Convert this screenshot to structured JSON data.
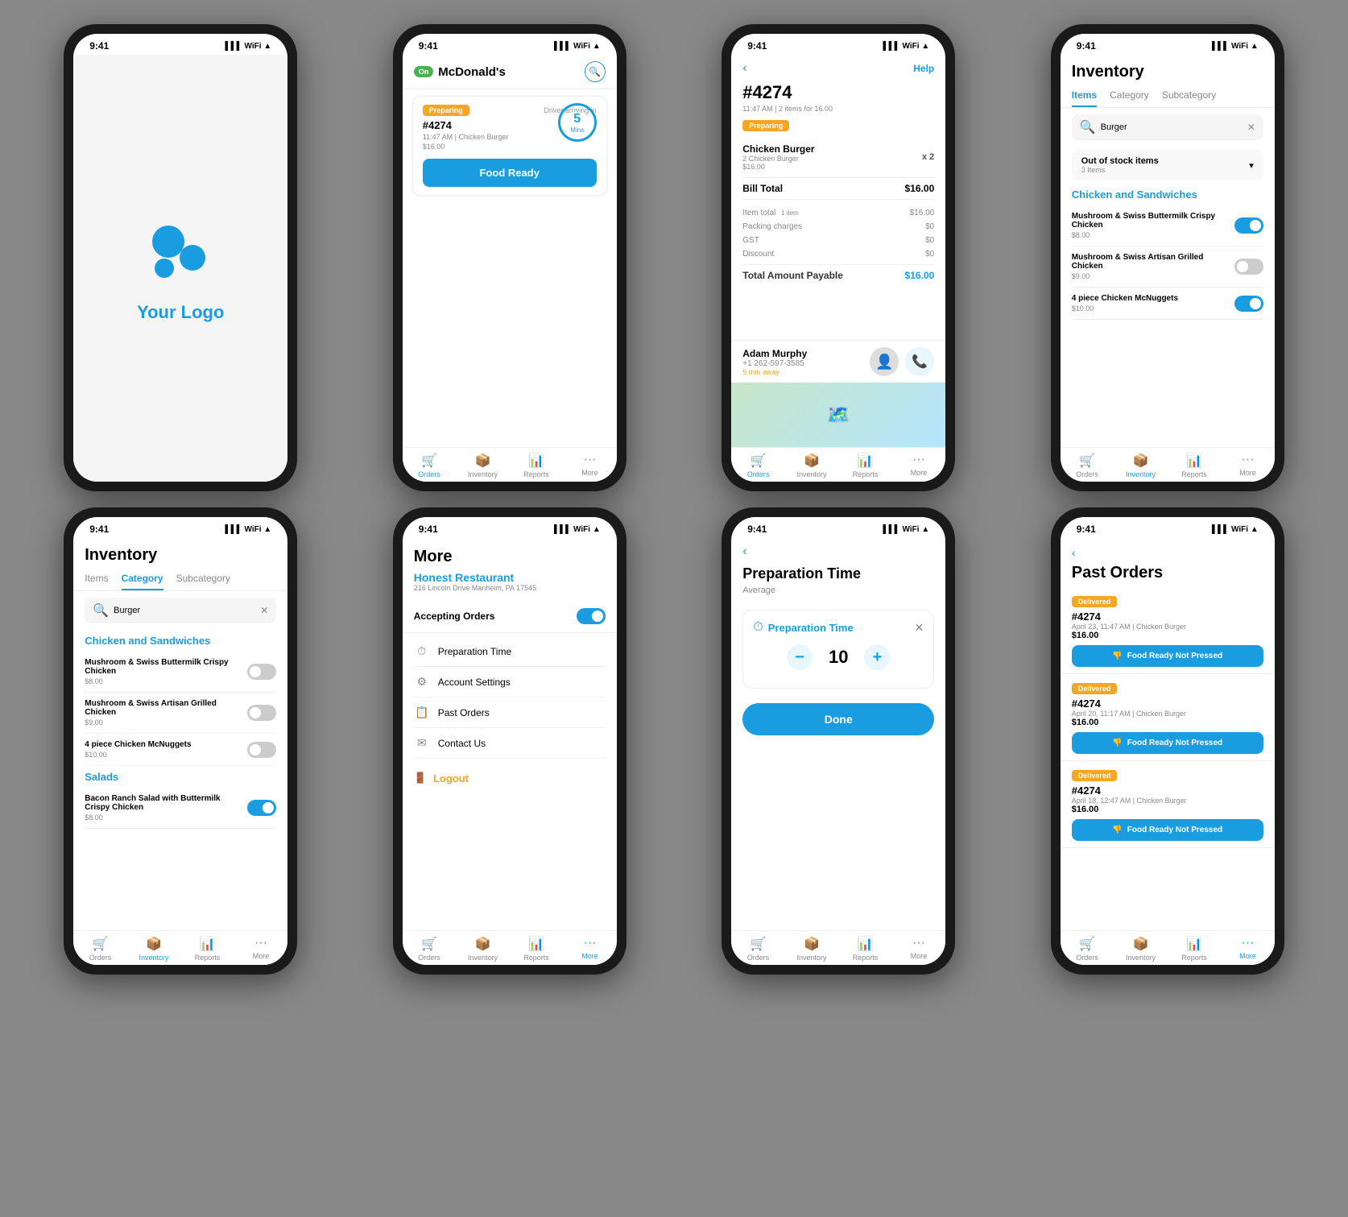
{
  "phones": [
    {
      "id": "logo",
      "time": "9:41",
      "logo_text": "Your Logo",
      "show_bottom_nav": false
    },
    {
      "id": "orders",
      "time": "9:41",
      "status": "On",
      "restaurant": "McDonald's",
      "preparing_label": "Preparing",
      "driver_arriving": "Driver arriving in",
      "order_num": "#4274",
      "order_time": "11:47 AM | Chicken Burger",
      "order_price": "$16.00",
      "timer_value": "5",
      "timer_unit": "Mins",
      "food_ready_btn": "Food Ready",
      "nav": [
        "Orders",
        "Inventory",
        "Reports",
        "More"
      ],
      "nav_active": 0
    },
    {
      "id": "order_detail",
      "time": "9:41",
      "order_num": "#4274",
      "order_meta": "11:47 AM | 2 items for 16.00",
      "preparing_label": "Preparing",
      "help_label": "Help",
      "item_name": "Chicken Burger",
      "item_qty": "x 2",
      "item_sub": "2 Chicken Burger",
      "item_sub_price": "$16.00",
      "bill_total_label": "Bill Total",
      "bill_total": "$16.00",
      "bill_rows": [
        {
          "label": "Item total",
          "note": "1 item",
          "value": "$16.00"
        },
        {
          "label": "Packing charges",
          "note": "",
          "value": "$0"
        },
        {
          "label": "GST",
          "note": "",
          "value": "$0"
        },
        {
          "label": "Discount",
          "note": "",
          "value": "$0"
        },
        {
          "label": "Total Amount Payable",
          "note": "",
          "value": "$16.00",
          "highlight": true
        }
      ],
      "driver_name": "Adam Murphy",
      "driver_phone": "+1 262-597-3585",
      "driver_eta": "5 min away",
      "nav": [
        "Orders",
        "Inventory",
        "Reports",
        "More"
      ],
      "nav_active": 0
    },
    {
      "id": "inventory_items",
      "time": "9:41",
      "title": "Inventory",
      "tabs": [
        "Items",
        "Category",
        "Subcategory"
      ],
      "active_tab": 0,
      "search_placeholder": "Burger",
      "out_of_stock": "Out of stock items",
      "out_of_stock_count": "3 Items",
      "section_title": "Chicken and Sandwiches",
      "items": [
        {
          "name": "Mushroom & Swiss Buttermilk Crispy Chicken",
          "price": "$8.00",
          "on": true
        },
        {
          "name": "Mushroom & Swiss Artisan Grilled Chicken",
          "price": "$9.00",
          "on": false
        },
        {
          "name": "4 piece Chicken McNuggets",
          "price": "$10.00",
          "on": true
        }
      ],
      "nav": [
        "Orders",
        "Inventory",
        "Reports",
        "More"
      ],
      "nav_active": 1
    },
    {
      "id": "inventory_category",
      "time": "9:41",
      "title": "Inventory",
      "tabs": [
        "Items",
        "Category",
        "Subcategory"
      ],
      "active_tab": 1,
      "search_placeholder": "Burger",
      "section1_title": "Chicken and Sandwiches",
      "items1": [
        {
          "name": "Mushroom & Swiss Buttermilk Crispy Chicken",
          "price": "$8.00",
          "on": false
        },
        {
          "name": "Mushroom & Swiss Artisan Grilled Chicken",
          "price": "$9.00",
          "on": false
        },
        {
          "name": "4 piece Chicken McNuggets",
          "price": "$10.00",
          "on": false
        }
      ],
      "section2_title": "Salads",
      "items2": [
        {
          "name": "Bacon Ranch Salad with Buttermilk Crispy Chicken",
          "price": "$8.00",
          "on": true
        }
      ],
      "nav": [
        "Orders",
        "Inventory",
        "Reports",
        "More"
      ],
      "nav_active": 1
    },
    {
      "id": "more",
      "time": "9:41",
      "title": "More",
      "restaurant_name": "Honest Restaurant",
      "restaurant_addr": "216 Lincoln Drive Manheim, PA 17545",
      "accepting_label": "Accepting Orders",
      "accepting_on": true,
      "menu_items": [
        {
          "icon": "⏱",
          "label": "Preparation Time"
        },
        {
          "icon": "⚙",
          "label": "Account Settings"
        },
        {
          "icon": "📋",
          "label": "Past Orders"
        },
        {
          "icon": "✉",
          "label": "Contact Us"
        }
      ],
      "logout_label": "Logout",
      "nav": [
        "Orders",
        "Inventory",
        "Reports",
        "More"
      ],
      "nav_active": 3
    },
    {
      "id": "prep_time",
      "time": "9:41",
      "title": "Preparation Time",
      "subtitle": "Average",
      "modal_title": "Preparation Time",
      "counter_value": "10",
      "done_label": "Done",
      "nav": [
        "Orders",
        "Inventory",
        "Reports",
        "More"
      ],
      "nav_active": -1
    },
    {
      "id": "past_orders",
      "time": "9:41",
      "back_label": "<",
      "title": "Past Orders",
      "orders": [
        {
          "status": "Delivered",
          "num": "#4274",
          "date": "April 23, 11:47 AM | Chicken Burger",
          "price": "$16.00",
          "btn": "Food Ready Not Pressed"
        },
        {
          "status": "Delivered",
          "num": "#4274",
          "date": "April 20, 11:17 AM | Chicken Burger",
          "price": "$16.00",
          "btn": "Food Ready Not Pressed"
        },
        {
          "status": "Delivered",
          "num": "#4274",
          "date": "April 18, 12:47 AM | Chicken Burger",
          "price": "$16.00",
          "btn": "Food Ready Not Pressed"
        }
      ],
      "nav": [
        "Orders",
        "Inventory",
        "Reports",
        "More"
      ],
      "nav_active": 3
    }
  ],
  "nav_icons": [
    "🛒",
    "📦",
    "📊",
    "···"
  ]
}
